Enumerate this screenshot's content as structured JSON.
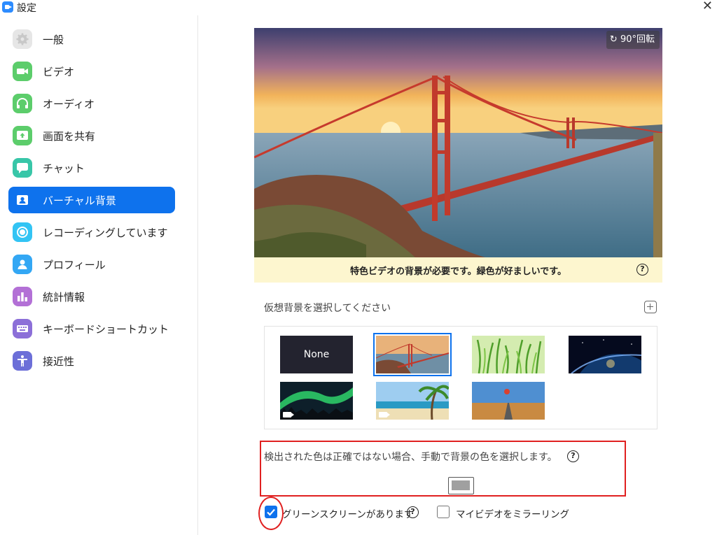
{
  "window": {
    "title": "設定"
  },
  "sidebar": {
    "items": [
      {
        "label": "一般",
        "icon": "gear-icon",
        "color": "#e5e5e5"
      },
      {
        "label": "ビデオ",
        "icon": "video-camera-icon",
        "color": "#5ccd6b"
      },
      {
        "label": "オーディオ",
        "icon": "headphones-icon",
        "color": "#5ccd6b"
      },
      {
        "label": "画面を共有",
        "icon": "share-screen-icon",
        "color": "#5ccd6b"
      },
      {
        "label": "チャット",
        "icon": "chat-bubble-icon",
        "color": "#38c6a8"
      },
      {
        "label": "バーチャル背景",
        "icon": "portrait-icon",
        "color": "#ffffff",
        "active": true
      },
      {
        "label": "レコーディングしています",
        "icon": "record-icon",
        "color": "#33c4f4"
      },
      {
        "label": "プロフィール",
        "icon": "person-icon",
        "color": "#33a7f4"
      },
      {
        "label": "統計情報",
        "icon": "bar-chart-icon",
        "color": "#b370d6"
      },
      {
        "label": "キーボードショートカット",
        "icon": "keyboard-icon",
        "color": "#8c6fd8"
      },
      {
        "label": "接近性",
        "icon": "accessibility-icon",
        "color": "#6c6fd8"
      }
    ]
  },
  "preview": {
    "rotate_label": "90°回転",
    "notice": "特色ビデオの背景が必要です。緑色が好ましいです。"
  },
  "background_picker": {
    "label": "仮想背景を選択してください",
    "thumbnails": [
      {
        "name": "None",
        "label": "None"
      },
      {
        "name": "golden-gate-bridge",
        "selected": true
      },
      {
        "name": "green-grass"
      },
      {
        "name": "earth-from-space"
      },
      {
        "name": "aurora-video",
        "video": true
      },
      {
        "name": "beach-video",
        "video": true
      },
      {
        "name": "hot-air-balloon-road"
      }
    ]
  },
  "color_detect": {
    "text": "検出された色は正確ではない場合、手動で背景の色を選択します。",
    "swatch_color": "#a0a0a0"
  },
  "options": {
    "green_screen_label": "グリーンスクリーンがあります",
    "green_screen_checked": true,
    "mirror_label": "マイビデオをミラーリング",
    "mirror_checked": false
  },
  "colors": {
    "accent": "#0e72ed",
    "highlight": "#e02020",
    "notice_bg": "#fdf6cf"
  }
}
